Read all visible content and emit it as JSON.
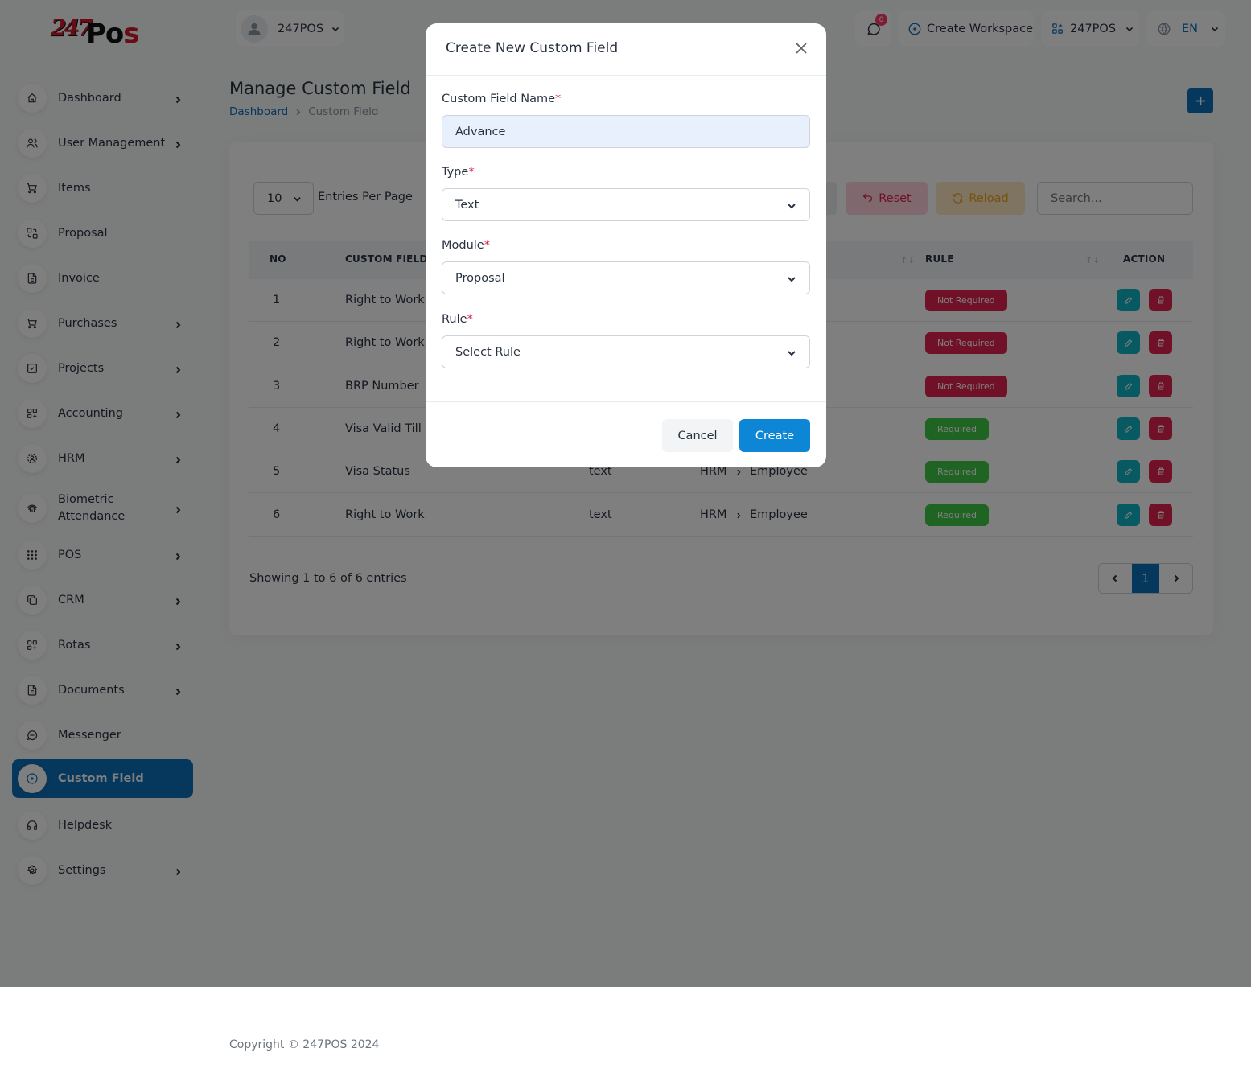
{
  "brand": {
    "logo_text": "247Pos"
  },
  "header": {
    "profile_name": "247POS",
    "notification_count": "0",
    "create_workspace": "Create Workspace",
    "workspace_name": "247POS",
    "language": "EN"
  },
  "sidebar": {
    "items": [
      {
        "label": "Dashboard",
        "icon": "home-icon",
        "chevron": true
      },
      {
        "label": "User Management",
        "icon": "users-icon",
        "chevron": true
      },
      {
        "label": "Items",
        "icon": "cart-icon",
        "chevron": false
      },
      {
        "label": "Proposal",
        "icon": "replace-icon",
        "chevron": false
      },
      {
        "label": "Invoice",
        "icon": "file-invoice-icon",
        "chevron": false
      },
      {
        "label": "Purchases",
        "icon": "cart-icon",
        "chevron": true
      },
      {
        "label": "Projects",
        "icon": "square-check-icon",
        "chevron": true
      },
      {
        "label": "Accounting",
        "icon": "layout-grid-add-icon",
        "chevron": true
      },
      {
        "label": "HRM",
        "icon": "user-circle-icon",
        "chevron": true
      },
      {
        "label": "Biometric Attendance",
        "icon": "fingerprint-icon",
        "chevron": true
      },
      {
        "label": "POS",
        "icon": "grid-dots-icon",
        "chevron": true
      },
      {
        "label": "CRM",
        "icon": "layers-icon",
        "chevron": true
      },
      {
        "label": "Rotas",
        "icon": "layout-grid-add-icon",
        "chevron": true
      },
      {
        "label": "Documents",
        "icon": "file-text-icon",
        "chevron": true
      },
      {
        "label": "Messenger",
        "icon": "message-icon",
        "chevron": false
      },
      {
        "label": "Custom Field",
        "icon": "circle-plus-icon",
        "chevron": false,
        "active": true
      },
      {
        "label": "Helpdesk",
        "icon": "headphones-icon",
        "chevron": false
      },
      {
        "label": "Settings",
        "icon": "settings-icon",
        "chevron": true
      }
    ]
  },
  "page": {
    "title": "Manage Custom Field",
    "breadcrumb": {
      "home": "Dashboard",
      "current": "Custom Field"
    }
  },
  "table_controls": {
    "per_page": "10",
    "per_page_label": "Entries Per Page",
    "reset_label": "Reset",
    "reload_label": "Reload",
    "search_placeholder": "Search..."
  },
  "table": {
    "columns": {
      "no": "NO",
      "custom_field": "CUSTOM FIELD",
      "rule": "RULE",
      "action": "ACTION"
    },
    "rows": [
      {
        "no": "1",
        "name": "Right to Work C",
        "type": "",
        "module": "",
        "sub": "",
        "rule": "Not Required",
        "rule_kind": "nr"
      },
      {
        "no": "2",
        "name": "Right to Work C",
        "type": "",
        "module": "",
        "sub": "",
        "rule": "Not Required",
        "rule_kind": "nr"
      },
      {
        "no": "3",
        "name": "BRP Number",
        "type": "",
        "module": "",
        "sub": "",
        "rule": "Not Required",
        "rule_kind": "nr"
      },
      {
        "no": "4",
        "name": "Visa Valid Till",
        "type": "",
        "module": "",
        "sub": "",
        "rule": "Required",
        "rule_kind": "r"
      },
      {
        "no": "5",
        "name": "Visa Status",
        "type": "text",
        "module": "HRM",
        "sub": "Employee",
        "rule": "Required",
        "rule_kind": "r"
      },
      {
        "no": "6",
        "name": "Right to Work",
        "type": "text",
        "module": "HRM",
        "sub": "Employee",
        "rule": "Required",
        "rule_kind": "r"
      }
    ],
    "showing": "Showing 1 to 6 of 6 entries",
    "current_page": "1"
  },
  "modal": {
    "title": "Create New Custom Field",
    "name_label": "Custom Field Name",
    "name_value": "Advance",
    "type_label": "Type",
    "type_value": "Text",
    "module_label": "Module",
    "module_value": "Proposal",
    "rule_label": "Rule",
    "rule_value": "Select Rule",
    "required_mark": "*",
    "cancel_label": "Cancel",
    "create_label": "Create"
  },
  "footer": {
    "copyright": "Copyright © 247POS 2024"
  },
  "colors": {
    "primary": "#0d6fb8",
    "danger": "#e0234f",
    "success": "#3ec946",
    "info": "#11b5c4",
    "warning": "#f0a21b"
  }
}
